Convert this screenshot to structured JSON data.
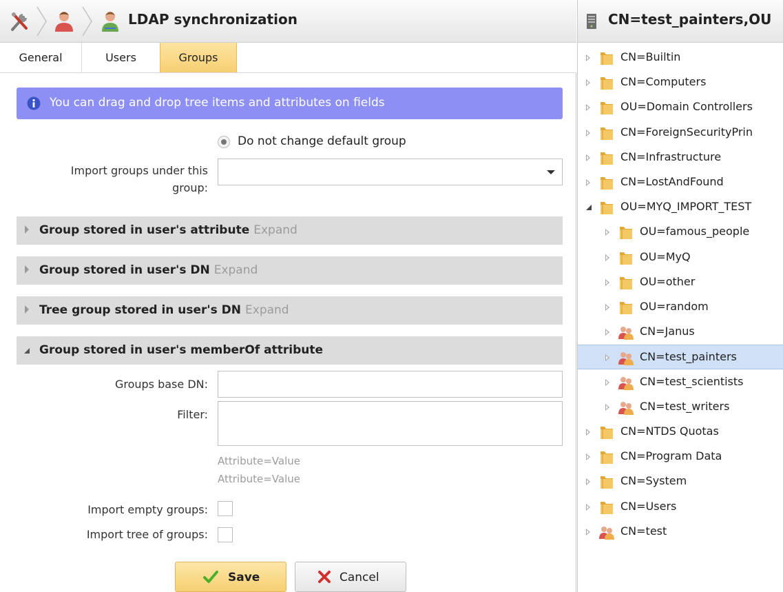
{
  "header": {
    "title": "LDAP synchronization",
    "breadcrumb_icons": [
      "tools-icon",
      "user-icon",
      "sync-user-icon"
    ]
  },
  "tabs": [
    {
      "label": "General",
      "active": false
    },
    {
      "label": "Users",
      "active": false
    },
    {
      "label": "Groups",
      "active": true
    }
  ],
  "info": {
    "text": "You can drag and drop tree items and attributes on fields"
  },
  "form": {
    "default_group_radio": "Do not change default group",
    "import_under_label_line1": "Import groups under this",
    "import_under_label_line2": "group:",
    "import_under_value": ""
  },
  "sections": [
    {
      "title": "Group stored in user's attribute",
      "action": "Expand",
      "expanded": false
    },
    {
      "title": "Group stored in user's DN",
      "action": "Expand",
      "expanded": false
    },
    {
      "title": "Tree group stored in user's DN",
      "action": "Expand",
      "expanded": false
    },
    {
      "title": "Group stored in user's memberOf attribute",
      "action": "",
      "expanded": true
    }
  ],
  "memberof": {
    "base_dn_label": "Groups base DN:",
    "base_dn_value": "",
    "filter_label": "Filter:",
    "filter_value": "",
    "hint_line1": "Attribute=Value",
    "hint_line2": "Attribute=Value",
    "import_empty_label": "Import empty groups:",
    "import_empty_checked": false,
    "import_tree_label": "Import tree of groups:",
    "import_tree_checked": false
  },
  "buttons": {
    "save": "Save",
    "cancel": "Cancel"
  },
  "tree": {
    "title": "CN=test_painters,OU",
    "items": [
      {
        "label": "CN=Builtin",
        "type": "folder",
        "level": 0,
        "state": "collapsed"
      },
      {
        "label": "CN=Computers",
        "type": "folder",
        "level": 0,
        "state": "collapsed"
      },
      {
        "label": "OU=Domain Controllers",
        "type": "folder",
        "level": 0,
        "state": "collapsed"
      },
      {
        "label": "CN=ForeignSecurityPrin",
        "type": "folder",
        "level": 0,
        "state": "collapsed"
      },
      {
        "label": "CN=Infrastructure",
        "type": "folder",
        "level": 0,
        "state": "collapsed"
      },
      {
        "label": "CN=LostAndFound",
        "type": "folder",
        "level": 0,
        "state": "collapsed"
      },
      {
        "label": "OU=MYQ_IMPORT_TEST",
        "type": "folder",
        "level": 0,
        "state": "expanded"
      },
      {
        "label": "OU=famous_people",
        "type": "folder",
        "level": 1,
        "state": "collapsed"
      },
      {
        "label": "OU=MyQ",
        "type": "folder",
        "level": 1,
        "state": "collapsed"
      },
      {
        "label": "OU=other",
        "type": "folder",
        "level": 1,
        "state": "collapsed"
      },
      {
        "label": "OU=random",
        "type": "folder",
        "level": 1,
        "state": "collapsed"
      },
      {
        "label": "CN=Janus",
        "type": "group",
        "level": 1,
        "state": "collapsed"
      },
      {
        "label": "CN=test_painters",
        "type": "group",
        "level": 1,
        "state": "collapsed",
        "selected": true
      },
      {
        "label": "CN=test_scientists",
        "type": "group",
        "level": 1,
        "state": "collapsed"
      },
      {
        "label": "CN=test_writers",
        "type": "group",
        "level": 1,
        "state": "collapsed"
      },
      {
        "label": "CN=NTDS Quotas",
        "type": "folder",
        "level": 0,
        "state": "collapsed"
      },
      {
        "label": "CN=Program Data",
        "type": "folder",
        "level": 0,
        "state": "collapsed"
      },
      {
        "label": "CN=System",
        "type": "folder",
        "level": 0,
        "state": "collapsed"
      },
      {
        "label": "CN=Users",
        "type": "folder",
        "level": 0,
        "state": "collapsed"
      },
      {
        "label": "CN=test",
        "type": "group",
        "level": 0,
        "state": "collapsed"
      }
    ]
  },
  "colors": {
    "info_bg": "#8d8ff5",
    "tab_active": "#f7cf72",
    "section_bg": "#dcdcdc",
    "tree_selected": "#cfe0f7",
    "folder": "#e9b343"
  }
}
